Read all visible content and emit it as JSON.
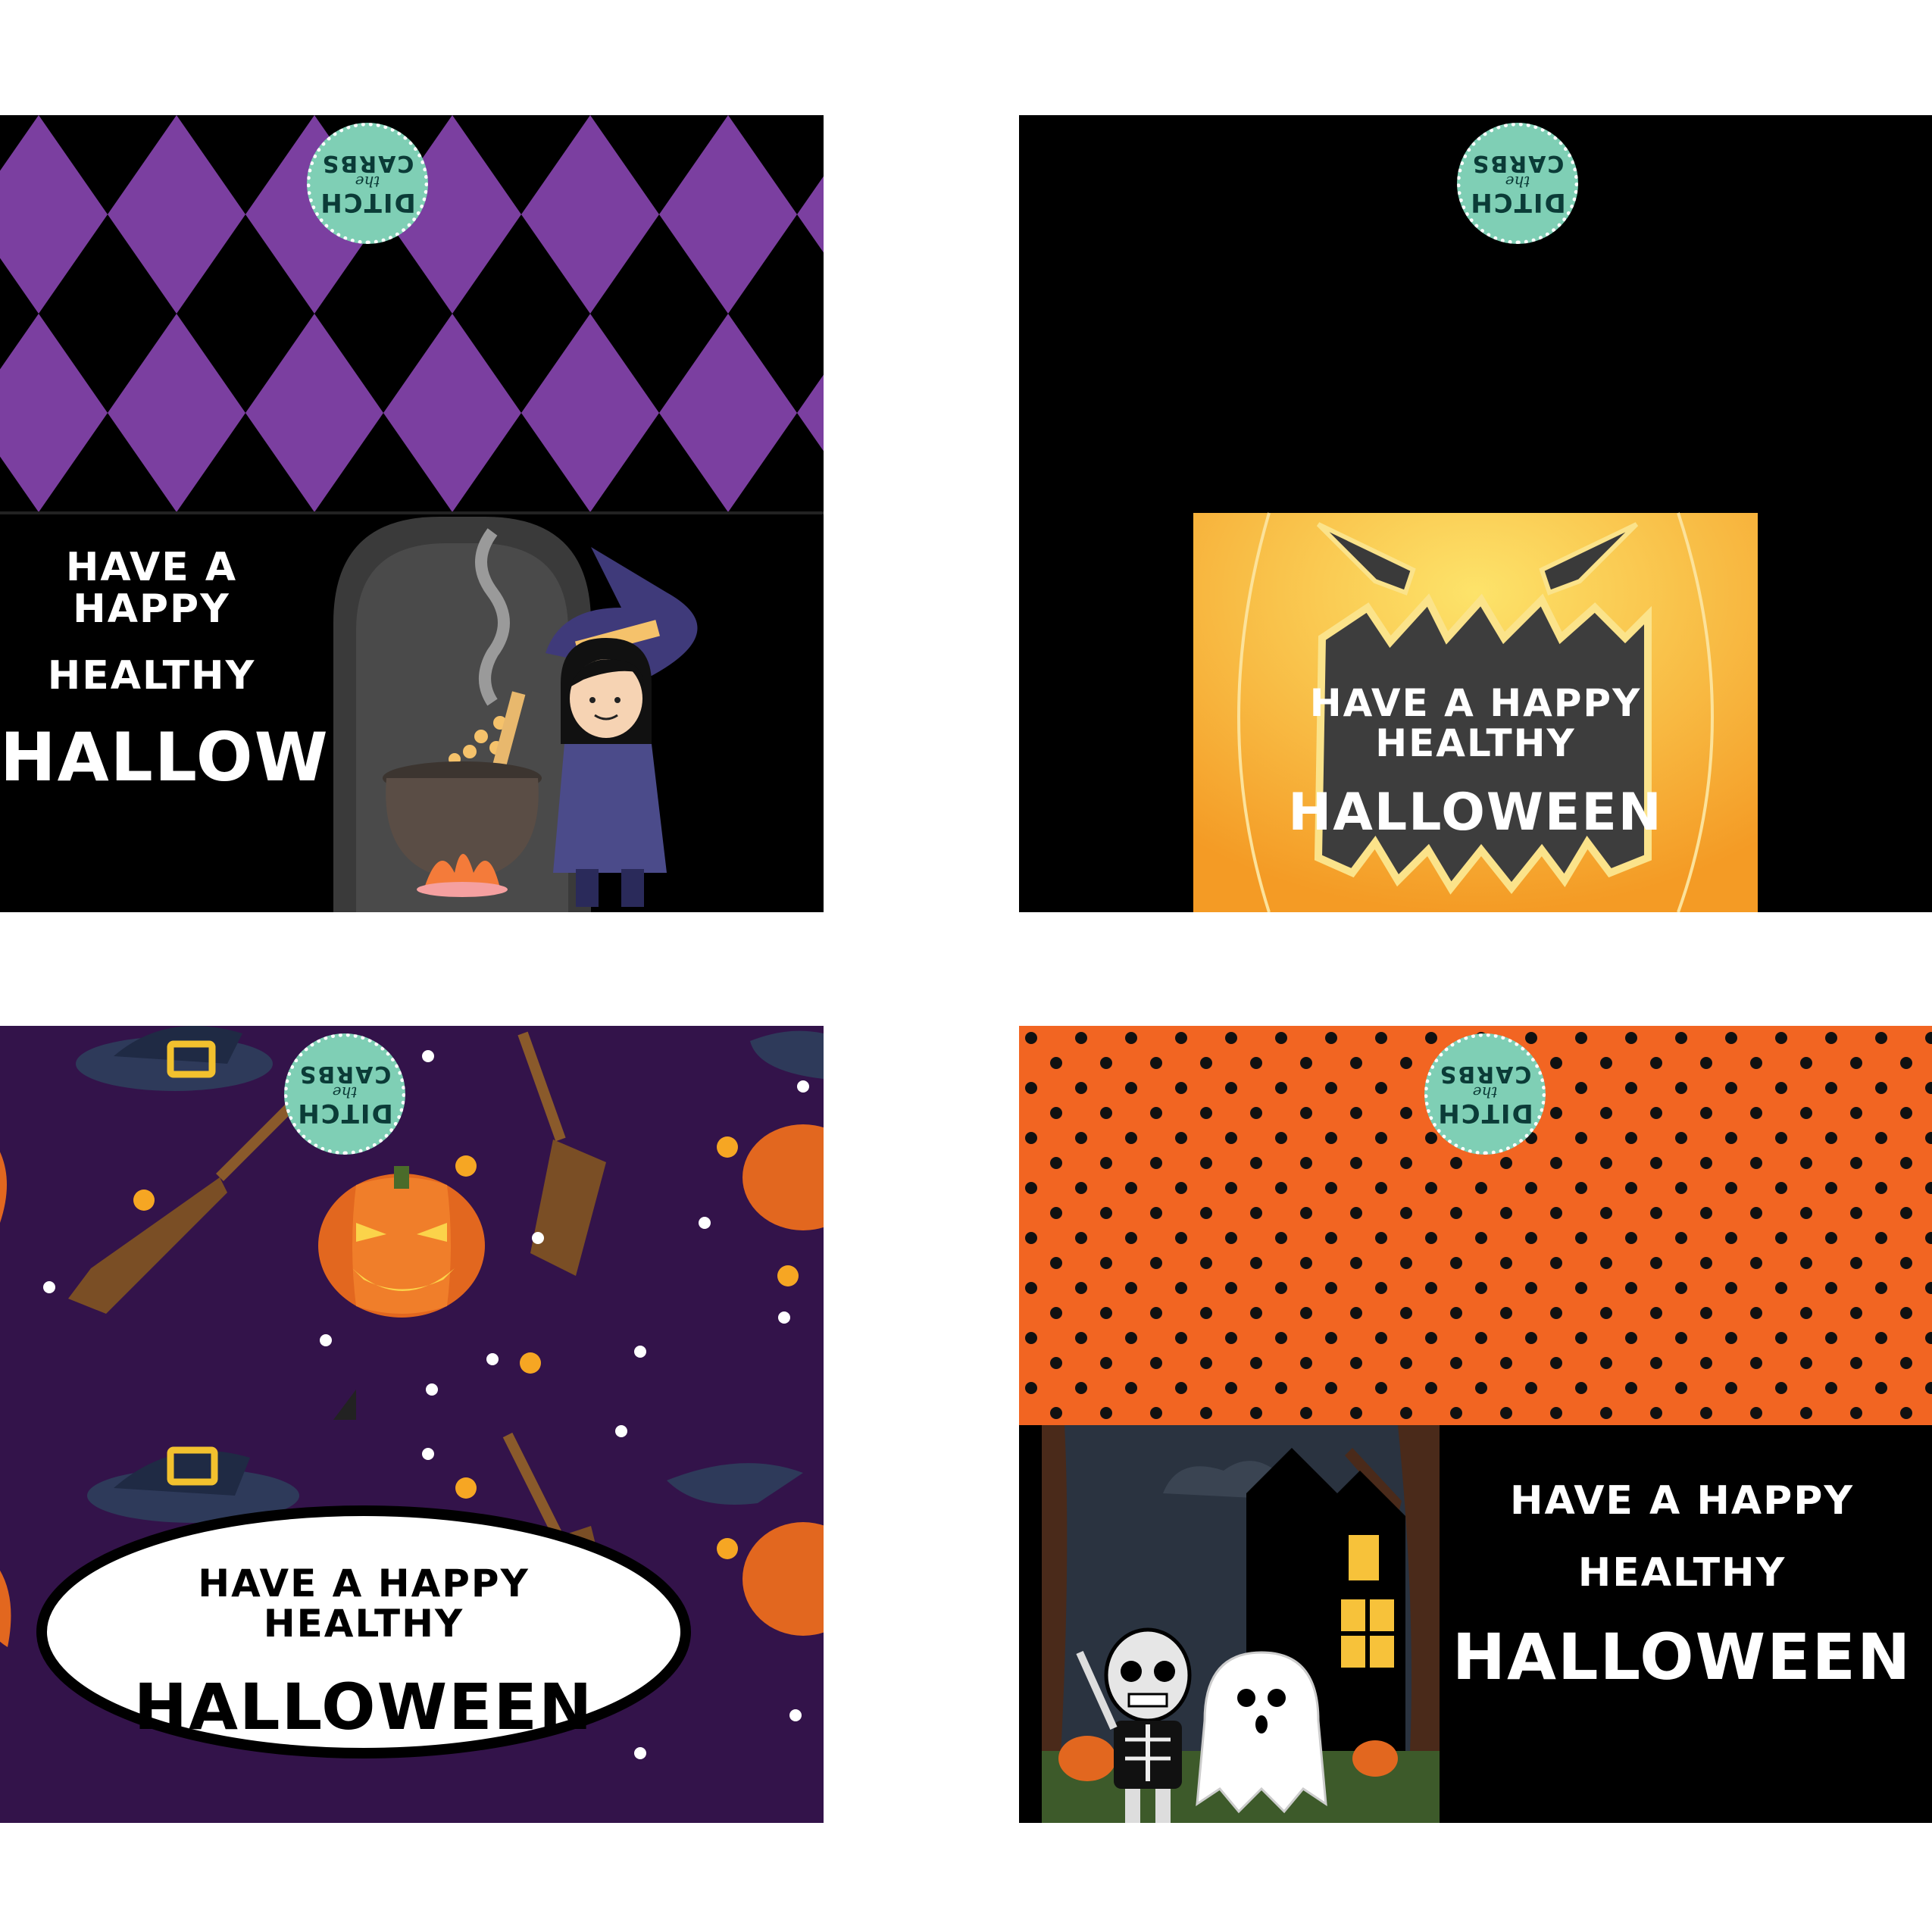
{
  "logo": {
    "line1": "DITCH",
    "line2": "the",
    "line3": "CARBS"
  },
  "cards": [
    {
      "id": "witch",
      "greeting": {
        "line1": "HAVE A HAPPY",
        "line2": "HEALTHY",
        "line3": "HALLOWEEN"
      }
    },
    {
      "id": "pumpkin",
      "greeting": {
        "line1": "HAVE A HAPPY HEALTHY",
        "line2": "HALLOWEEN"
      }
    },
    {
      "id": "broom",
      "greeting": {
        "line1": "HAVE A HAPPY HEALTHY",
        "line2": "HALLOWEEN"
      }
    },
    {
      "id": "polka",
      "greeting": {
        "line1": "HAVE A HAPPY",
        "line2": "HEALTHY",
        "line3": "HALLOWEEN"
      }
    }
  ],
  "colors": {
    "purple": "#7b3fa0",
    "black": "#000000",
    "orange": "#f26522",
    "dark_purple": "#33134a",
    "pumpkin_yellow": "#f9b233",
    "logo_teal": "#7fcfb5"
  },
  "icons": [
    "witch-cauldron-illustration",
    "jack-o-lantern-face",
    "witch-hat-icon",
    "broom-icon",
    "pumpkin-icon",
    "haunted-house-illustration",
    "skeleton-icon",
    "ghost-icon"
  ]
}
